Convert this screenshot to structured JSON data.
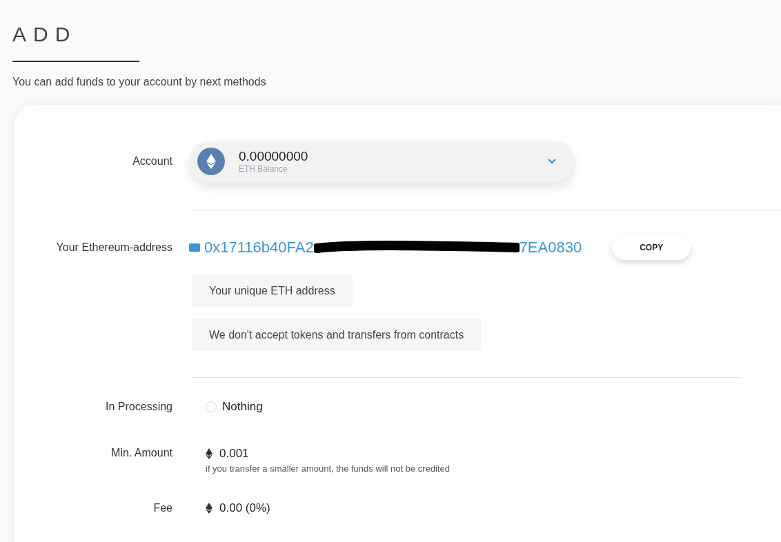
{
  "title": "ADD",
  "subtitle": "You can add funds to your account by next methods",
  "account": {
    "label": "Account",
    "amount": "0.00000000",
    "caption": "ETH Balance"
  },
  "address": {
    "label": "Your Ethereum-address",
    "prefix": "0x17116b40FA2",
    "suffix": "7EA0830",
    "redacted": true,
    "copy": "COPY"
  },
  "notes": [
    "Your unique ETH address",
    "We don't accept tokens and transfers from contracts"
  ],
  "processing": {
    "label": "In Processing",
    "value": "Nothing"
  },
  "min_amount": {
    "label": "Min. Amount",
    "value": "0.001",
    "hint": "if you transfer a smaller amount, the funds will not be credited"
  },
  "fee": {
    "label": "Fee",
    "value": "0.00 (0%)"
  }
}
